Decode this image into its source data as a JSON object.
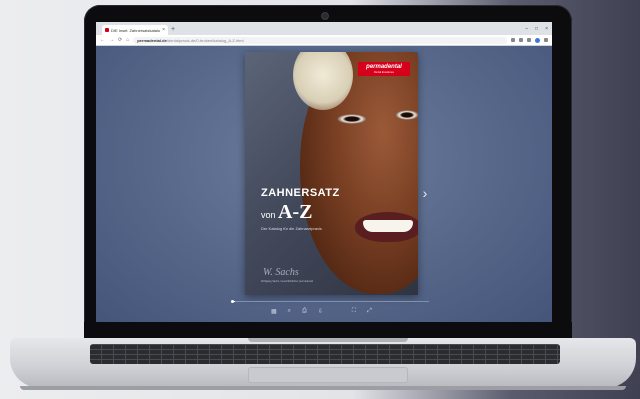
{
  "browser": {
    "tab_title": "DIE Insel: Zahnersatzkatalog_A-Z",
    "tab_close": "×",
    "new_tab": "+",
    "window_controls": [
      "–",
      "□",
      "×"
    ],
    "address_domain": "permadental.de",
    "address_path": "/dentalpraxis-de/0-broken/katalog_A-Z.html",
    "nav_back": "←",
    "nav_forward": "→",
    "nav_reload": "⟳",
    "nav_home": "⌂"
  },
  "viewer": {
    "brand": "permadental",
    "brand_tagline": "Dental Excellence",
    "title_line1": "ZAHNERSATZ",
    "title_von": "von ",
    "title_az": "A-Z",
    "subtitle": "Der Katalog für die Zahnarztpraxis",
    "signature": "W. Sachs",
    "signature_sub": "Wolfgang Sachs, Geschäftsführer permadental",
    "next_arrow": "›",
    "progress": 0.01,
    "toolbar": [
      "▦",
      "⌕",
      "⎙",
      "⇩",
      "⛶",
      "⤢"
    ]
  }
}
